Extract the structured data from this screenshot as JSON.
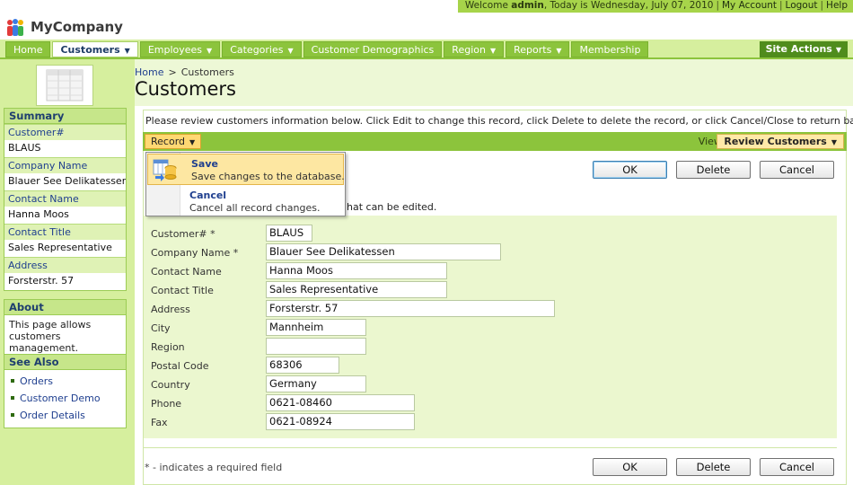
{
  "header": {
    "app_name": "MyCompany",
    "welcome_prefix": "Welcome",
    "username": "admin",
    "date_text": ", Today is Wednesday, July 07, 2010",
    "links": [
      "My Account",
      "Logout",
      "Help"
    ]
  },
  "nav": {
    "items": [
      {
        "label": "Home",
        "dropdown": false,
        "active": false
      },
      {
        "label": "Customers",
        "dropdown": true,
        "active": true
      },
      {
        "label": "Employees",
        "dropdown": true,
        "active": false
      },
      {
        "label": "Categories",
        "dropdown": true,
        "active": false
      },
      {
        "label": "Customer Demographics",
        "dropdown": false,
        "active": false
      },
      {
        "label": "Region",
        "dropdown": true,
        "active": false
      },
      {
        "label": "Reports",
        "dropdown": true,
        "active": false
      },
      {
        "label": "Membership",
        "dropdown": false,
        "active": false
      }
    ],
    "site_actions": "Site Actions"
  },
  "sidebar": {
    "summary": {
      "title": "Summary",
      "fields": [
        {
          "label": "Customer#",
          "value": "BLAUS"
        },
        {
          "label": "Company Name",
          "value": "Blauer See Delikatessen"
        },
        {
          "label": "Contact Name",
          "value": "Hanna Moos"
        },
        {
          "label": "Contact Title",
          "value": "Sales Representative"
        },
        {
          "label": "Address",
          "value": "Forsterstr. 57"
        }
      ]
    },
    "about": {
      "title": "About",
      "text": "This page allows customers management."
    },
    "see_also": {
      "title": "See Also",
      "links": [
        "Orders",
        "Customer Demo",
        "Order Details"
      ]
    }
  },
  "breadcrumb": {
    "home": "Home",
    "separator": ">",
    "current": "Customers"
  },
  "page_title": "Customers",
  "instruction": "Please review customers information below. Click Edit to change this record, click Delete to delete the record, or click Cancel/Close to return back.",
  "toolbar": {
    "record_label": "Record",
    "view_label": "View:",
    "view_value": "Review Customers"
  },
  "record_menu": {
    "items": [
      {
        "title": "Save",
        "description": "Save changes to the database."
      },
      {
        "title": "Cancel",
        "description": "Cancel all record changes."
      }
    ]
  },
  "actions": {
    "ok": "OK",
    "delete": "Delete",
    "cancel": "Cancel"
  },
  "edit_hint": "hat can be edited.",
  "form": {
    "fields": [
      {
        "label": "Customer# *",
        "value": "BLAUS"
      },
      {
        "label": "Company Name *",
        "value": "Blauer See Delikatessen"
      },
      {
        "label": "Contact Name",
        "value": "Hanna Moos"
      },
      {
        "label": "Contact Title",
        "value": "Sales Representative"
      },
      {
        "label": "Address",
        "value": "Forsterstr. 57"
      },
      {
        "label": "City",
        "value": "Mannheim"
      },
      {
        "label": "Region",
        "value": ""
      },
      {
        "label": "Postal Code",
        "value": "68306"
      },
      {
        "label": "Country",
        "value": "Germany"
      },
      {
        "label": "Phone",
        "value": "0621-08460"
      },
      {
        "label": "Fax",
        "value": "0621-08924"
      }
    ]
  },
  "required_note": "* - indicates a required field",
  "colors": {
    "accent_green": "#8cc43c",
    "background_green": "#d6ef9e",
    "highlight_yellow": "#fde7a2",
    "link_blue": "#1f3f8f"
  }
}
